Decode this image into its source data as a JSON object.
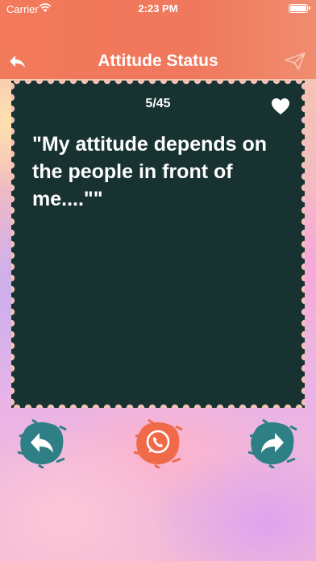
{
  "status_bar": {
    "carrier": "Carrier",
    "time": "2:23 PM"
  },
  "nav": {
    "title": "Attitude Status",
    "back_icon": "reply-arrow-icon",
    "send_icon": "paper-plane-icon"
  },
  "card": {
    "counter": "5/45",
    "quote": "\"My attitude depends on the people in front of me....\"\"",
    "favorite_icon": "heart-icon"
  },
  "actions": {
    "previous_icon": "reply-arrow-icon",
    "whatsapp_icon": "whatsapp-icon",
    "next_icon": "forward-arrow-icon"
  },
  "colors": {
    "header": "#f2795a",
    "card_bg": "#173231",
    "teal_button": "#2e7f86",
    "orange_button": "#f06a4a"
  }
}
